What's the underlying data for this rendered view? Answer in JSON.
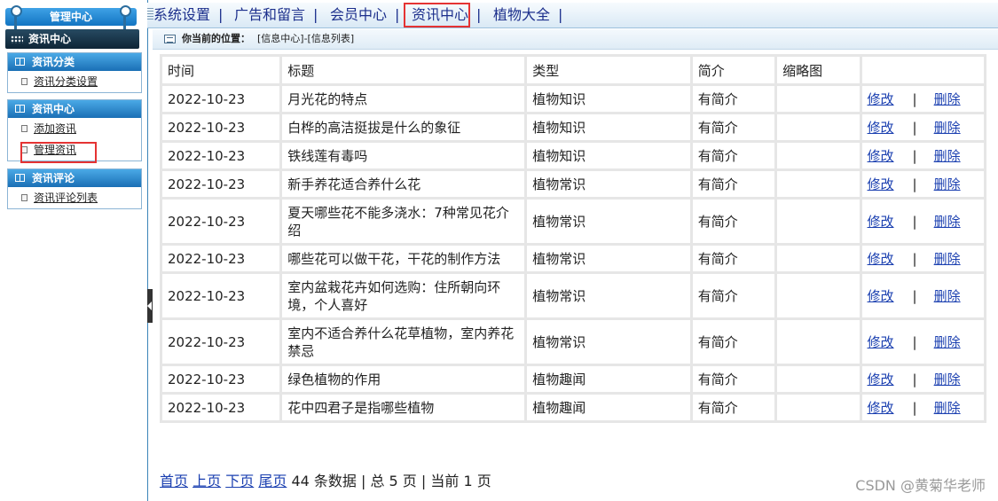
{
  "sidebar": {
    "title": "管理中心",
    "current_section": "资讯中心",
    "panels": [
      {
        "header": "资讯分类",
        "items": [
          "资讯分类设置"
        ]
      },
      {
        "header": "资讯中心",
        "items": [
          "添加资讯",
          "管理资讯"
        ]
      },
      {
        "header": "资讯评论",
        "items": [
          "资讯评论列表"
        ]
      }
    ]
  },
  "topnav": {
    "items": [
      "系统设置",
      "广告和留言",
      "会员中心",
      "资讯中心",
      "植物大全"
    ],
    "separator": "|",
    "active": "资讯中心"
  },
  "breadcrumb": {
    "label": "你当前的位置：",
    "path": "[信息中心]-[信息列表]"
  },
  "table": {
    "headers": [
      "时间",
      "标题",
      "类型",
      "简介",
      "缩略图",
      ""
    ],
    "edit_label": "修改",
    "delete_label": "删除",
    "action_sep": "|",
    "rows": [
      {
        "date": "2022-10-23",
        "title": "月光花的特点",
        "type": "植物知识",
        "intro": "有简介",
        "thumb": ""
      },
      {
        "date": "2022-10-23",
        "title": "白桦的高洁挺拔是什么的象征",
        "type": "植物知识",
        "intro": "有简介",
        "thumb": ""
      },
      {
        "date": "2022-10-23",
        "title": "铁线莲有毒吗",
        "type": "植物知识",
        "intro": "有简介",
        "thumb": ""
      },
      {
        "date": "2022-10-23",
        "title": "新手养花适合养什么花",
        "type": "植物常识",
        "intro": "有简介",
        "thumb": ""
      },
      {
        "date": "2022-10-23",
        "title": "夏天哪些花不能多浇水：7种常见花介绍",
        "type": "植物常识",
        "intro": "有简介",
        "thumb": ""
      },
      {
        "date": "2022-10-23",
        "title": "哪些花可以做干花，干花的制作方法",
        "type": "植物常识",
        "intro": "有简介",
        "thumb": ""
      },
      {
        "date": "2022-10-23",
        "title": "室内盆栽花卉如何选购：住所朝向环境，个人喜好",
        "type": "植物常识",
        "intro": "有简介",
        "thumb": ""
      },
      {
        "date": "2022-10-23",
        "title": "室内不适合养什么花草植物，室内养花禁忌",
        "type": "植物常识",
        "intro": "有简介",
        "thumb": ""
      },
      {
        "date": "2022-10-23",
        "title": "绿色植物的作用",
        "type": "植物趣闻",
        "intro": "有简介",
        "thumb": ""
      },
      {
        "date": "2022-10-23",
        "title": "花中四君子是指哪些植物",
        "type": "植物趣闻",
        "intro": "有简介",
        "thumb": ""
      }
    ]
  },
  "pager": {
    "first": "首页",
    "prev": "上页",
    "next": "下页",
    "last": "尾页",
    "summary": "44 条数据 | 总 5 页 | 当前 1 页"
  },
  "watermark": "CSDN @黄菊华老师"
}
